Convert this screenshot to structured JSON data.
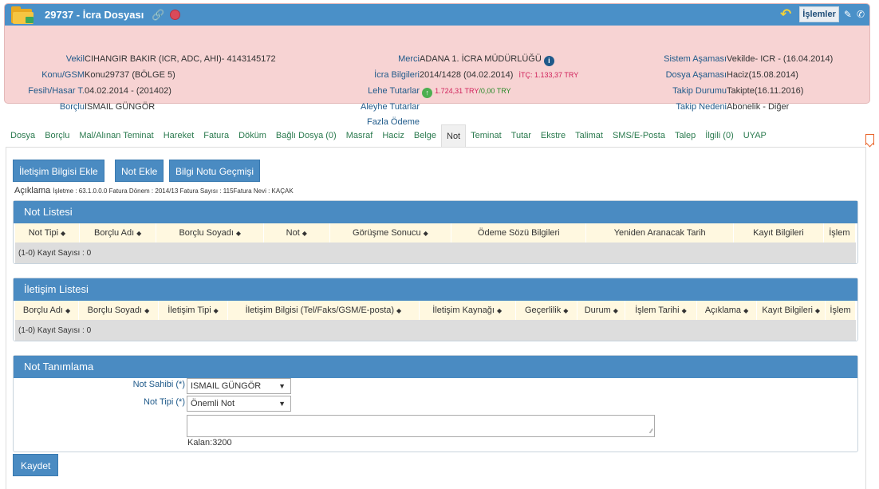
{
  "header": {
    "title": "29737 - İcra Dosyası",
    "islemler": "İşlemler",
    "col1": [
      {
        "label": "Vekil",
        "value": "CIHANGIR BAKIR (ICR, ADC, AHI)- 4143145172"
      },
      {
        "label": "Konu/GSM",
        "value": "Konu29737 (BÖLGE 5)"
      },
      {
        "label": "Fesih/Hasar T.",
        "value": "04.02.2014 - (201402)"
      },
      {
        "label": "Borçlu",
        "value": "ISMAIL GÜNGÖR"
      }
    ],
    "col2": [
      {
        "label": "Merci",
        "value": "ADANA 1. İCRA MÜDÜRLÜĞÜ"
      },
      {
        "label": "İcra Bilgileri",
        "value": "2014/1428 (04.02.2014)",
        "extra": "İTÇ: 1.133,37 TRY"
      },
      {
        "label": "Lehe Tutarlar",
        "value_red": "1.724,31 TRY",
        "value_green": "/0,00 TRY"
      },
      {
        "label": "Aleyhe Tutarlar",
        "value": ""
      },
      {
        "label": "Fazla Ödeme",
        "value": ""
      }
    ],
    "col3": [
      {
        "label": "Sistem Aşaması",
        "value": "Vekilde- ICR - (16.04.2014)"
      },
      {
        "label": "Dosya Aşaması",
        "value": "Haciz(15.08.2014)"
      },
      {
        "label": "Takip Durumu",
        "value": "Takipte(16.11.2016)"
      },
      {
        "label": "Takip Nedeni",
        "value": "Abonelik - Diğer"
      }
    ]
  },
  "tabs": [
    "Dosya",
    "Borçlu",
    "Mal/Alınan Teminat",
    "Hareket",
    "Fatura",
    "Döküm",
    "Bağlı Dosya (0)",
    "Masraf",
    "Haciz",
    "Belge",
    "Not",
    "Teminat",
    "Tutar",
    "Ekstre",
    "Talimat",
    "SMS/E-Posta",
    "Talep",
    "İlgili (0)",
    "UYAP"
  ],
  "active_tab": "Not",
  "buttons": {
    "iletisim_ekle": "İletişim Bilgisi Ekle",
    "not_ekle": "Not Ekle",
    "bilgi_notu": "Bilgi Notu Geçmişi"
  },
  "aciklama": {
    "label": "Açıklama",
    "text": "İşletme : 63.1.0.0.0 Fatura Dönem : 2014/13 Fatura Sayısı : 115Fatura Nevi : KAÇAK"
  },
  "not_listesi": {
    "title": "Not Listesi",
    "columns": [
      "Not Tipi",
      "Borçlu Adı",
      "Borçlu Soyadı",
      "Not",
      "Görüşme Sonucu",
      "Ödeme Sözü Bilgileri",
      "Yeniden Aranacak Tarih",
      "Kayıt Bilgileri",
      "İşlem"
    ],
    "footer": "(1-0) Kayıt Sayısı : 0"
  },
  "iletisim_listesi": {
    "title": "İletişim Listesi",
    "columns": [
      "Borçlu Adı",
      "Borçlu Soyadı",
      "İletişim Tipi",
      "İletişim Bilgisi (Tel/Faks/GSM/E-posta)",
      "İletişim Kaynağı",
      "Geçerlilik",
      "Durum",
      "İşlem Tarihi",
      "Açıklama",
      "Kayıt Bilgileri",
      "İşlem"
    ],
    "footer": "(1-0) Kayıt Sayısı : 0"
  },
  "not_tanimlama": {
    "title": "Not Tanımlama",
    "not_sahibi_label": "Not Sahibi (*)",
    "not_sahibi_value": "ISMAIL GÜNGÖR",
    "not_tipi_label": "Not Tipi (*)",
    "not_tipi_value": "Önemli Not",
    "kalan": "Kalan:3200",
    "save": "Kaydet"
  }
}
